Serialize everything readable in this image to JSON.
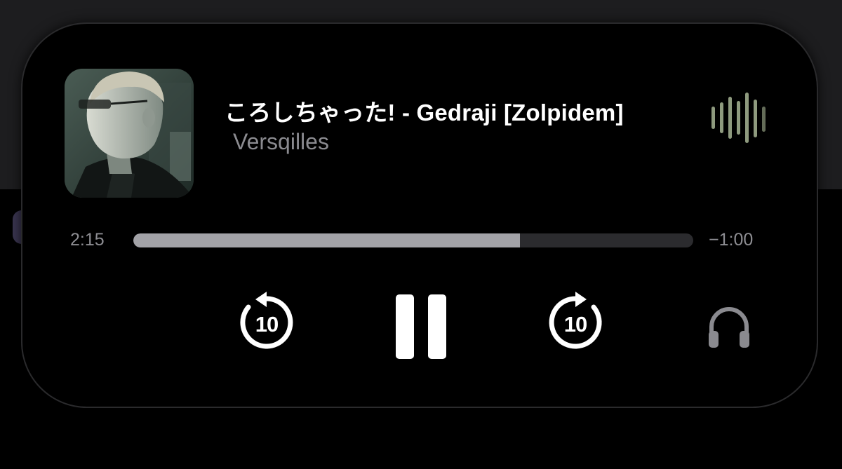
{
  "now_playing": {
    "title": "ころしちゃった! - Gedraji [Zolpidem]",
    "artist": "Versqilles",
    "artwork_icon": "album-artwork"
  },
  "playback": {
    "elapsed": "2:15",
    "remaining": "−1:00",
    "progress_fraction": 0.69
  },
  "controls": {
    "skip_back_seconds": "10",
    "skip_forward_seconds": "10",
    "play_state_icon": "pause-icon",
    "output_icon": "headphones-icon"
  },
  "colors": {
    "island_bg": "#000000",
    "title": "#ffffff",
    "artist": "#8b8b90",
    "progress_fill": "#a2a2a7",
    "progress_track": "#2b2b2e",
    "eq_bars": "#8e9a7e",
    "headphones": "#8a8a8f"
  }
}
